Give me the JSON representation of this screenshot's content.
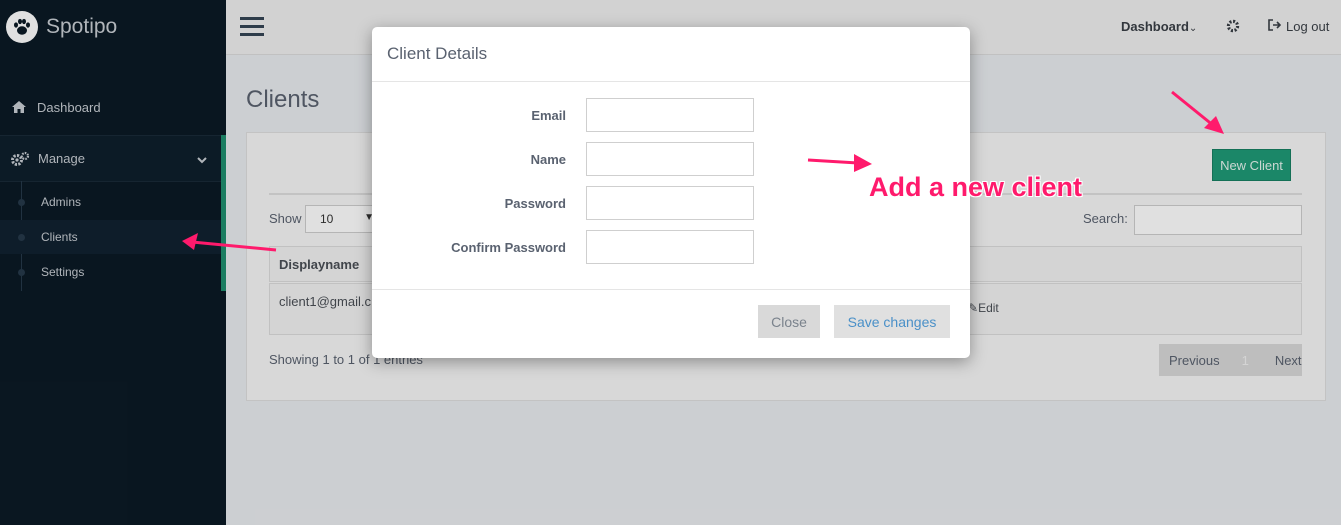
{
  "sidebar": {
    "brand": "Spotipo",
    "brand_icon": "paw-icon",
    "items": [
      {
        "label": "Dashboard",
        "icon": "home-icon"
      },
      {
        "label": "Manage",
        "icon": "gears-icon"
      }
    ],
    "submenu": [
      {
        "label": "Admins"
      },
      {
        "label": "Clients"
      },
      {
        "label": "Settings"
      }
    ]
  },
  "topbar": {
    "dashboard_label": "Dashboard",
    "logout_label": "Log out"
  },
  "main": {
    "page_title": "Clients",
    "new_client_label": "New Client",
    "show_label": "Show",
    "show_value": "10",
    "search_label": "Search:",
    "table": {
      "headers": [
        "Displayname"
      ],
      "rows": [
        {
          "displayname": "client1@gmail.c",
          "action": "Edit"
        }
      ]
    },
    "showing_text": "Showing 1 to 1 of 1 entries",
    "pager": {
      "previous": "Previous",
      "page": "1",
      "next": "Next"
    }
  },
  "modal": {
    "title": "Client Details",
    "fields": [
      {
        "label": "Email",
        "value": ""
      },
      {
        "label": "Name",
        "value": ""
      },
      {
        "label": "Password",
        "value": ""
      },
      {
        "label": "Confirm Password",
        "value": ""
      }
    ],
    "close_label": "Close",
    "save_label": "Save changes"
  },
  "annotation": {
    "text": "Add a new client",
    "color": "#ff1a6c"
  },
  "colors": {
    "sidebar_bg": "#0b1a25",
    "accent_green": "#1f9a77",
    "link_blue": "#4a90c8"
  }
}
